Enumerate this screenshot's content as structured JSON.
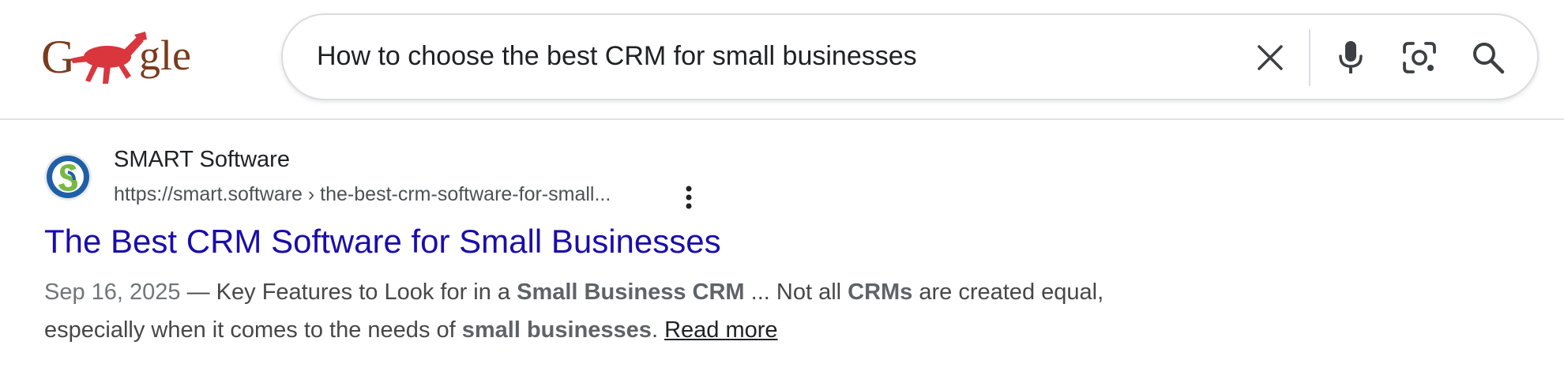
{
  "search": {
    "query": "How to choose the best CRM for small businesses"
  },
  "icons": {
    "logo": "google-doodle-logo",
    "clear": "close-icon",
    "voice": "microphone-icon",
    "lens": "lens-camera-icon",
    "search": "search-icon",
    "more": "more-vert-icon",
    "favicon": "smart-software-favicon"
  },
  "logo": {
    "text_g": "G",
    "text_rest": "gle"
  },
  "result": {
    "site_name": "SMART Software",
    "url": "https://smart.software › the-best-crm-software-for-small...",
    "title": "The Best CRM Software for Small Businesses",
    "date": "Sep 16, 2025",
    "dash": " — ",
    "snippet_1": "Key Features to Look for in a ",
    "snippet_b1": "Small Business CRM",
    "snippet_2": " ... Not all ",
    "snippet_b2": "CRMs",
    "snippet_3": " are created equal, especially when it comes to the needs of ",
    "snippet_b3": "small businesses",
    "snippet_4": ".  ",
    "read_more": "Read more"
  },
  "colors": {
    "title_link": "#1a0dab",
    "logo_brown": "#7a3b1e",
    "logo_red": "#d9363e",
    "favicon_blue": "#1f5fa8",
    "favicon_green": "#78b843"
  }
}
